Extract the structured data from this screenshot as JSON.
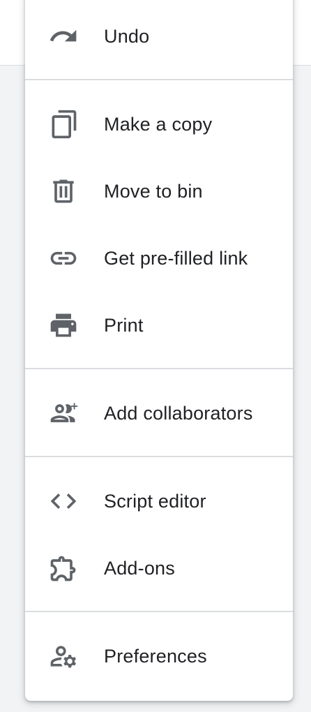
{
  "menu": {
    "items": [
      {
        "label": "Undo",
        "icon": "undo-icon"
      },
      {
        "label": "Make a copy",
        "icon": "copy-icon"
      },
      {
        "label": "Move to bin",
        "icon": "trash-icon"
      },
      {
        "label": "Get pre-filled link",
        "icon": "link-icon"
      },
      {
        "label": "Print",
        "icon": "printer-icon"
      },
      {
        "label": "Add collaborators",
        "icon": "add-people-icon"
      },
      {
        "label": "Script editor",
        "icon": "code-icon"
      },
      {
        "label": "Add-ons",
        "icon": "puzzle-icon"
      },
      {
        "label": "Preferences",
        "icon": "person-settings-icon"
      }
    ]
  },
  "colors": {
    "icon": "#5f6368",
    "text": "#202124",
    "divider": "#dadce0",
    "background": "#f1f3f4"
  }
}
